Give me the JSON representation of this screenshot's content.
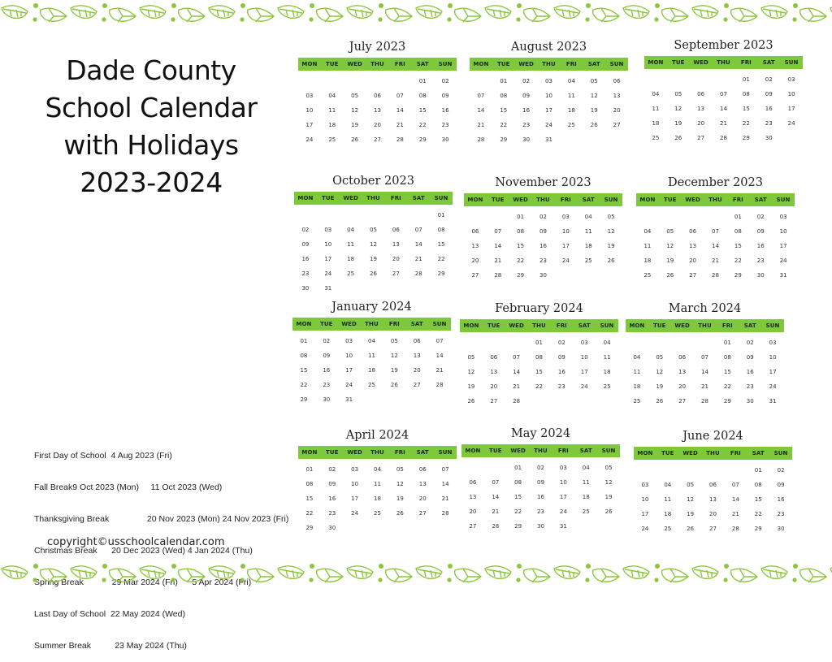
{
  "title_lines": [
    "Dade County",
    "School Calendar",
    "with Holidays",
    "2023-2024"
  ],
  "colors": {
    "header_green": "#7dc93a",
    "leaf_green": "#8cc63f"
  },
  "weekdays": [
    "MON",
    "TUE",
    "WED",
    "THU",
    "FRI",
    "SAT",
    "SUN"
  ],
  "months": [
    {
      "name": "July 2023",
      "offset": 5,
      "days": 30
    },
    {
      "name": "August 2023",
      "offset": 1,
      "days": 31
    },
    {
      "name": "September 2023",
      "offset": 4,
      "days": 30
    },
    {
      "name": "October 2023",
      "offset": 6,
      "days": 31
    },
    {
      "name": "November 2023",
      "offset": 2,
      "days": 30
    },
    {
      "name": "December 2023",
      "offset": 4,
      "days": 31
    },
    {
      "name": "January 2024",
      "offset": 0,
      "days": 31
    },
    {
      "name": "February 2024",
      "offset": 3,
      "days": 28
    },
    {
      "name": "March 2024",
      "offset": 4,
      "days": 31
    },
    {
      "name": "April 2024",
      "offset": 0,
      "days": 30
    },
    {
      "name": "May 2024",
      "offset": 2,
      "days": 31
    },
    {
      "name": "June 2024",
      "offset": 5,
      "days": 30
    }
  ],
  "holidays": [
    "First Day of School  4 Aug 2023 (Fri)",
    "Fall Break9 Oct 2023 (Mon)     11 Oct 2023 (Wed)",
    "Thanksgiving Break                20 Nov 2023 (Mon) 24 Nov 2023 (Fri)",
    "Christmas Break      20 Dec 2023 (Wed) 4 Jan 2024 (Thu)",
    "Spring Break            29 Mar 2024 (Fri)      5 Apr 2024 (Fri)",
    "Last Day of School  22 May 2024 (Wed)",
    "Summer Break          23 May 2024 (Thu)"
  ],
  "copyright": "copyright©usschoolcalendar.com",
  "decor": {
    "border_icon": "leaf-vine-icon"
  }
}
